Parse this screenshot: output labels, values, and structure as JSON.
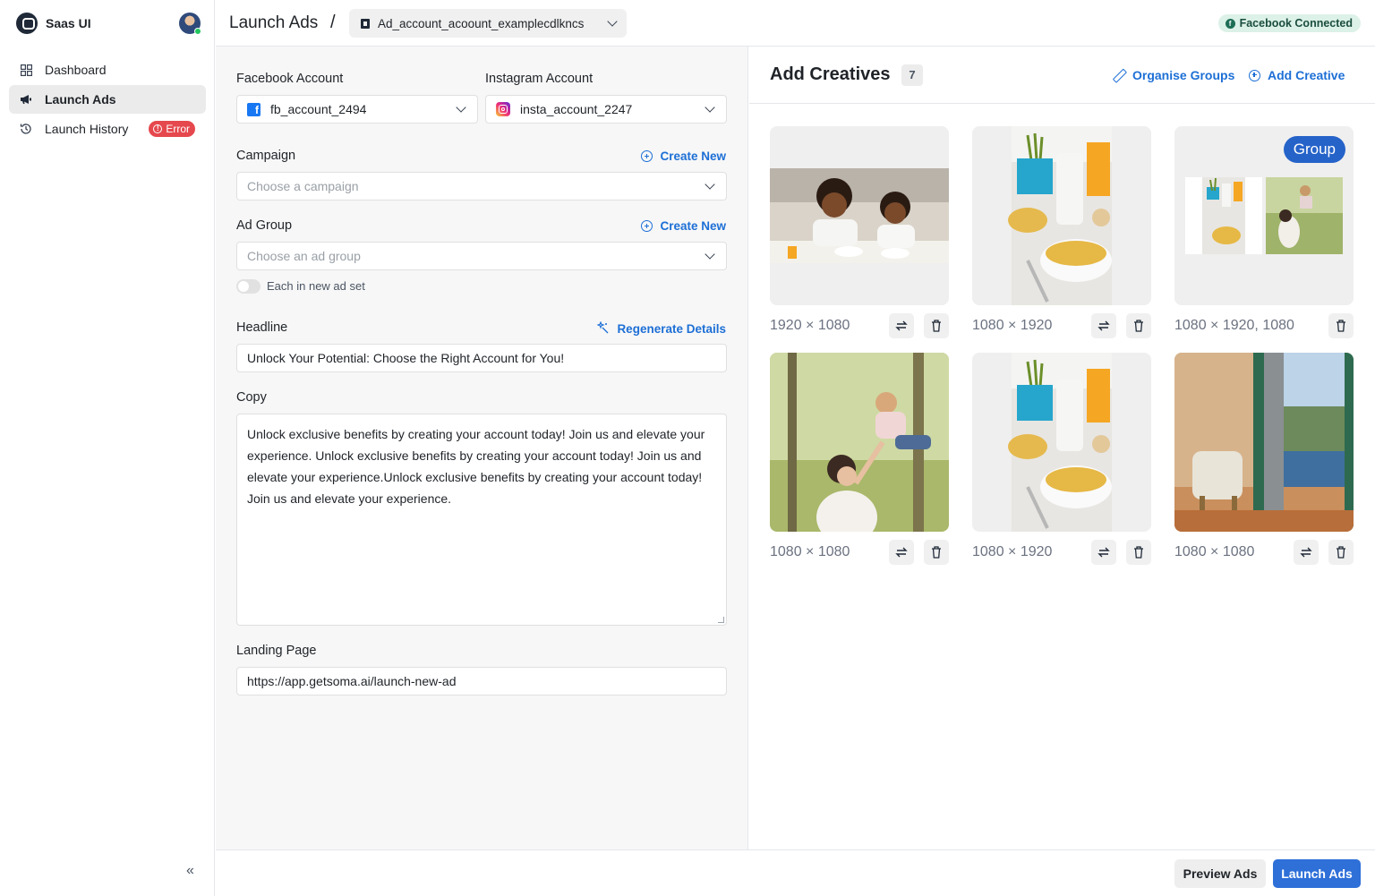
{
  "app": {
    "name": "Saas UI"
  },
  "sidebar": {
    "items": [
      {
        "label": "Dashboard",
        "icon": "grid-icon"
      },
      {
        "label": "Launch Ads",
        "icon": "megaphone-icon",
        "active": true
      },
      {
        "label": "Launch History",
        "icon": "history-icon",
        "badge": "Error"
      }
    ],
    "collapse_glyph": "«"
  },
  "header": {
    "title": "Launch Ads",
    "separator": "/",
    "account": "Ad_account_acoount_examplecdlkncs",
    "status": "Facebook Connected"
  },
  "form": {
    "facebook": {
      "label": "Facebook Account",
      "value": "fb_account_2494"
    },
    "instagram": {
      "label": "Instagram Account",
      "value": "insta_account_2247"
    },
    "campaign": {
      "label": "Campaign",
      "placeholder": "Choose a campaign",
      "action": "Create New"
    },
    "ad_group": {
      "label": "Ad Group",
      "placeholder": "Choose an ad group",
      "action": "Create New",
      "toggle_label": "Each in new ad set",
      "toggle_on": false
    },
    "headline": {
      "label": "Headline",
      "action": "Regenerate Details",
      "value": "Unlock Your Potential: Choose the Right Account for You!"
    },
    "copy": {
      "label": "Copy",
      "value": "Unlock exclusive benefits by creating your account today! Join us and elevate your experience. Unlock exclusive benefits by creating your account today! Join us and elevate your experience.Unlock exclusive benefits by creating your account today! Join us and elevate your experience."
    },
    "landing": {
      "label": "Landing Page",
      "value": "https://app.getsoma.ai/launch-new-ad"
    }
  },
  "creatives": {
    "title": "Add Creatives",
    "count": "7",
    "organise_label": "Organise Groups",
    "add_label": "Add Creative",
    "items": [
      {
        "dims": "1920 × 1080",
        "image": "mother-daughter-breakfast"
      },
      {
        "dims": "1080 × 1920",
        "image": "cereal-milk-juice"
      },
      {
        "dims": "1080 × 1920, 1080",
        "image": "group-cereal-and-play",
        "badge": "Group"
      },
      {
        "dims": "1080 × 1080",
        "image": "mother-lifting-child"
      },
      {
        "dims": "1080 × 1920",
        "image": "cereal-milk-juice"
      },
      {
        "dims": "1080 × 1080",
        "image": "room-sea-view"
      }
    ]
  },
  "footer": {
    "preview_label": "Preview Ads",
    "launch_label": "Launch Ads"
  },
  "colors": {
    "accent": "#2e6fd8",
    "link": "#1d6fd6",
    "error": "#e5484d",
    "connected_bg": "#dcf1e7"
  }
}
